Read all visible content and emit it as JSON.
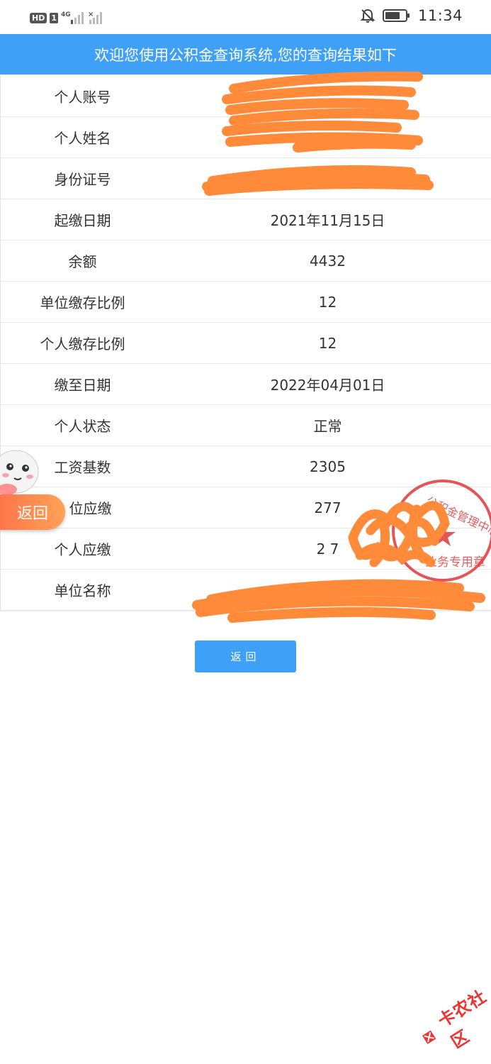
{
  "status_bar": {
    "hd_badge": "HD",
    "sim_badge": "1",
    "network": "4G",
    "time": "11:34",
    "icons": [
      "signal-icon",
      "wifi-off-icon",
      "mute-bell-icon",
      "battery-icon"
    ]
  },
  "header": {
    "title": "欢迎您使用公积金查询系统,您的查询结果如下"
  },
  "rows": [
    {
      "label": "个人账号",
      "value": ""
    },
    {
      "label": "个人姓名",
      "value": ""
    },
    {
      "label": "身份证号",
      "value": ""
    },
    {
      "label": "起缴日期",
      "value": "2021年11月15日"
    },
    {
      "label": "余额",
      "value": "4432"
    },
    {
      "label": "单位缴存比例",
      "value": "12"
    },
    {
      "label": "个人缴存比例",
      "value": "12"
    },
    {
      "label": "缴至日期",
      "value": "2022年04月01日"
    },
    {
      "label": "个人状态",
      "value": "正常"
    },
    {
      "label": "工资基数",
      "value": "2305"
    },
    {
      "label": "位应缴",
      "value": "277"
    },
    {
      "label": "个人应缴",
      "value": "2 7"
    },
    {
      "label": "单位名称",
      "value": ""
    }
  ],
  "return_button": {
    "label": "返回"
  },
  "float_widget": {
    "label": "返回"
  },
  "stamp": {
    "text": "公积金管理中心 业务专用章"
  },
  "watermark": {
    "text": "卡农社区"
  },
  "colors": {
    "primary": "#3fa0f7",
    "scribble": "#ff8a3a",
    "stamp": "#e0373a"
  }
}
